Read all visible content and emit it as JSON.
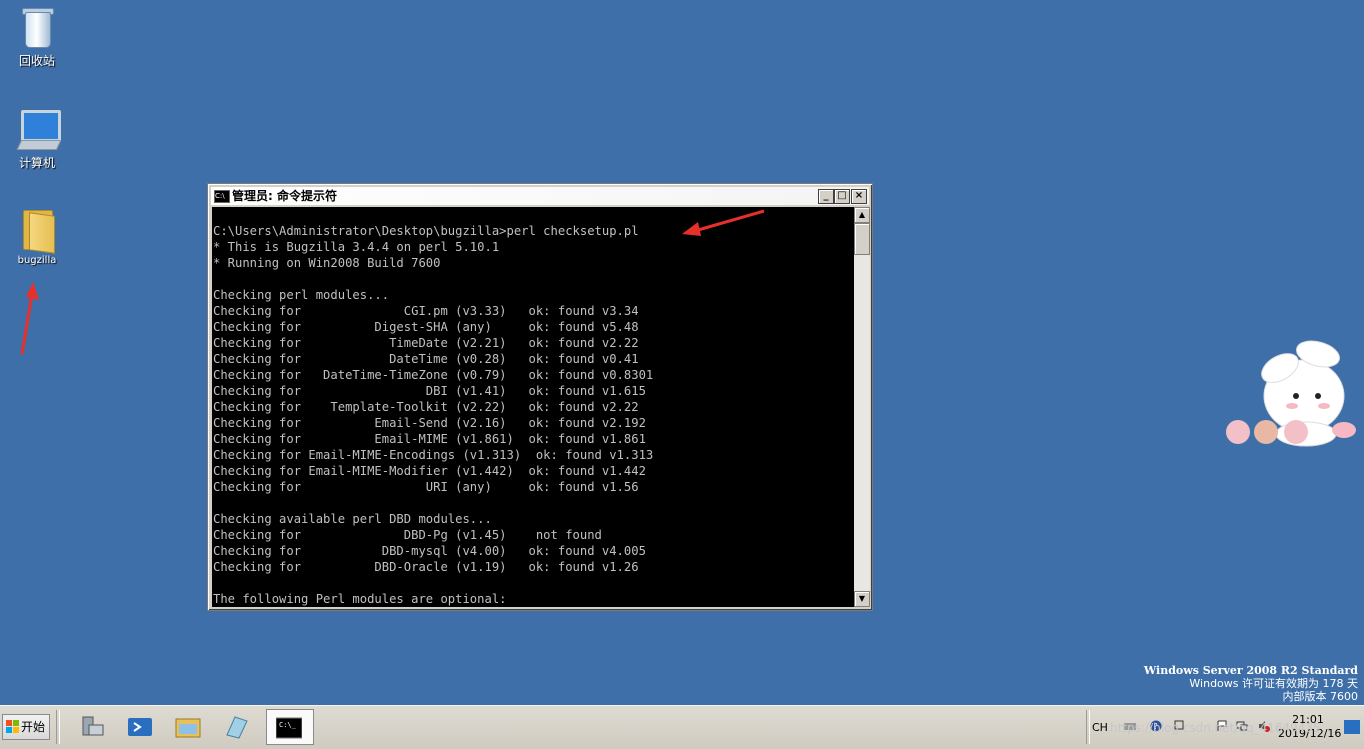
{
  "desktop": {
    "icons": [
      {
        "label": "回收站"
      },
      {
        "label": "计算机"
      },
      {
        "label": "bugzilla"
      }
    ]
  },
  "cmd": {
    "title": "管理员: 命令提示符",
    "icon_text": "C:\\",
    "lines": [
      "",
      "C:\\Users\\Administrator\\Desktop\\bugzilla>perl checksetup.pl",
      "* This is Bugzilla 3.4.4 on perl 5.10.1",
      "* Running on Win2008 Build 7600",
      "",
      "Checking perl modules...",
      "Checking for              CGI.pm (v3.33)   ok: found v3.34",
      "Checking for          Digest-SHA (any)     ok: found v5.48",
      "Checking for            TimeDate (v2.21)   ok: found v2.22",
      "Checking for            DateTime (v0.28)   ok: found v0.41",
      "Checking for   DateTime-TimeZone (v0.79)   ok: found v0.8301",
      "Checking for                 DBI (v1.41)   ok: found v1.615",
      "Checking for    Template-Toolkit (v2.22)   ok: found v2.22",
      "Checking for          Email-Send (v2.16)   ok: found v2.192",
      "Checking for          Email-MIME (v1.861)  ok: found v1.861",
      "Checking for Email-MIME-Encodings (v1.313)  ok: found v1.313",
      "Checking for Email-MIME-Modifier (v1.442)  ok: found v1.442",
      "Checking for                 URI (any)     ok: found v1.56",
      "",
      "Checking available perl DBD modules...",
      "Checking for              DBD-Pg (v1.45)    not found",
      "Checking for           DBD-mysql (v4.00)   ok: found v4.005",
      "Checking for          DBD-Oracle (v1.19)   ok: found v1.26",
      "",
      "The following Perl modules are optional:"
    ]
  },
  "watermark": {
    "line1": "Windows Server 2008 R2 Standard",
    "line2": "Windows 许可证有效期为 178 天",
    "line3": "内部版本 7600"
  },
  "taskbar": {
    "start_label": "开始",
    "lang": "CH",
    "time": "21:01",
    "date": "2019/12/16",
    "overlay": "https://blog.csdn.net/qq_41649435"
  },
  "colors": {
    "desktop": "#3f6fa9",
    "console_bg": "#000000",
    "console_fg": "#c0c0c0",
    "arrow": "#e8302a"
  }
}
